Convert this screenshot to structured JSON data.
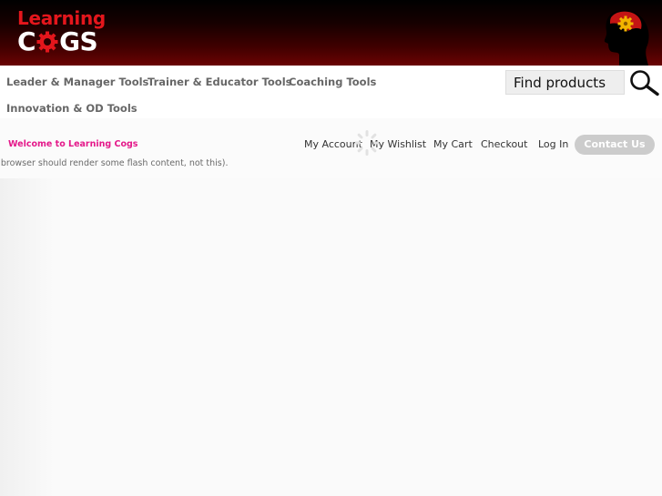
{
  "brand": {
    "logo_line1": "Learning",
    "logo_line2_prefix": "C",
    "logo_line2_suffix": "GS",
    "accent_red": "#e4161c",
    "accent_pink": "#e4198a",
    "gear_color": "#f2b400"
  },
  "nav": {
    "items": [
      {
        "label": "Leader & Manager Tools"
      },
      {
        "label": "Trainer & Educator Tools"
      },
      {
        "label": "Coaching Tools"
      },
      {
        "label": "Innovation & OD Tools"
      }
    ],
    "search": {
      "placeholder": "Find products"
    }
  },
  "topbar": {
    "welcome": "Welcome to Learning Cogs",
    "links": [
      {
        "label": "My Account"
      },
      {
        "label": "My Wishlist"
      },
      {
        "label": "My Cart"
      },
      {
        "label": "Checkout"
      },
      {
        "label": "Log In"
      }
    ],
    "contact_label": "Contact Us"
  },
  "flash_message": "e browser should render some flash content, not this)."
}
